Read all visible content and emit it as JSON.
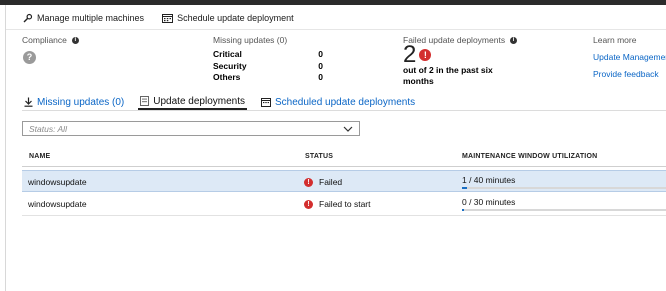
{
  "toolbar": {
    "manage_label": "Manage multiple machines",
    "schedule_label": "Schedule update deployment"
  },
  "compliance": {
    "label": "Compliance",
    "status_glyph": "?"
  },
  "missing_updates": {
    "label": "Missing updates (0)",
    "rows": [
      {
        "label": "Critical",
        "value": "0"
      },
      {
        "label": "Security",
        "value": "0"
      },
      {
        "label": "Others",
        "value": "0"
      }
    ]
  },
  "failed_deployments": {
    "label": "Failed update deployments",
    "count": "2",
    "subtitle": "out of 2 in the past six months"
  },
  "learn_more": {
    "label": "Learn more",
    "links": [
      "Update Management",
      "Provide feedback"
    ]
  },
  "tabs": [
    {
      "label": "Missing updates (0)",
      "icon": "download-icon",
      "active": false
    },
    {
      "label": "Update deployments",
      "icon": "deployment-icon",
      "active": true
    },
    {
      "label": "Scheduled update deployments",
      "icon": "calendar-icon",
      "active": false
    }
  ],
  "filter": {
    "value": "Status: All"
  },
  "table": {
    "columns": [
      "NAME",
      "STATUS",
      "MAINTENANCE WINDOW UTILIZATION"
    ],
    "rows": [
      {
        "name": "windowsupdate",
        "status": "Failed",
        "utilization": "1 / 40 minutes",
        "fraction": 0.025,
        "selected": true
      },
      {
        "name": "windowsupdate",
        "status": "Failed to start",
        "utilization": "0 / 30 minutes",
        "fraction": 0.0,
        "selected": false
      }
    ]
  },
  "colors": {
    "link": "#0b66c6",
    "error": "#d32e2e",
    "selected_row": "#dde9f6",
    "progress": "#1a6fc4"
  }
}
